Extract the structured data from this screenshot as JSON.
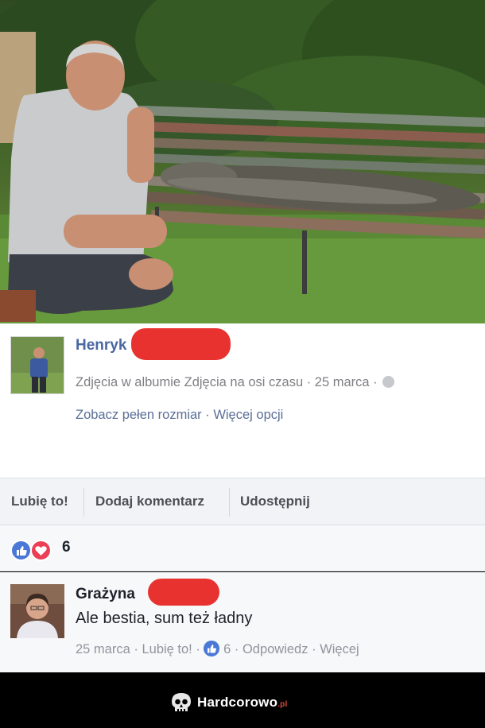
{
  "post": {
    "author": "Henryk",
    "meta_prefix": "Zdjęcia w albumie Zdjęcia na osi czasu · 25 marca ·",
    "links": "Zobacz pełen rozmiar · Więcej opcji"
  },
  "actions": {
    "like": "Lubię to!",
    "comment": "Dodaj komentarz",
    "share": "Udostępnij"
  },
  "reactions": {
    "count": "6"
  },
  "comment": {
    "author": "Grażyna",
    "text": "Ale bestia, sum też ładny",
    "date": "25 marca",
    "like": "Lubię to!",
    "likes": "6",
    "reply": "Odpowiedz",
    "more": "Więcej"
  },
  "footer": {
    "brand": "Hardcorowo",
    "tld": ".pl"
  },
  "colors": {
    "link": "#4b67a1",
    "redaction": "#e8322f",
    "like": "#4a78d6",
    "love": "#ea3f55"
  }
}
